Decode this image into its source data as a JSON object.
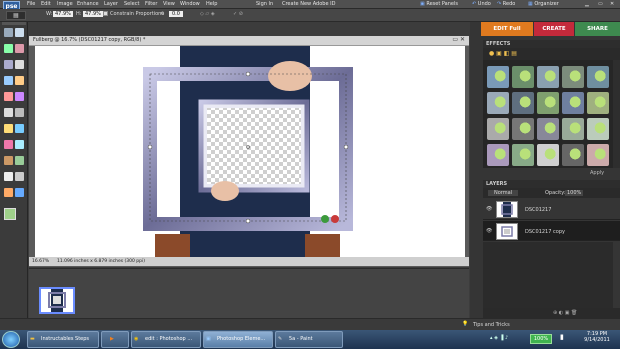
{
  "app": {
    "logo_text": "pse",
    "menu": [
      "File",
      "Edit",
      "Image",
      "Enhance",
      "Layer",
      "Select",
      "Filter",
      "View",
      "Window",
      "Help"
    ],
    "sign_in": "Sign In",
    "create_id": "Create New Adobe ID",
    "reset_panels": "Reset Panels",
    "undo": "Undo",
    "redo": "Redo",
    "organizer": "Organizer"
  },
  "options": {
    "width_label": "W:",
    "width_value": "47.9%",
    "height_label": "H:",
    "height_value": "47.9%",
    "constrain_label": "Constrain Proportions",
    "angle_value": "0.0"
  },
  "tabs": {
    "edit": "EDIT Full",
    "create": "CREATE",
    "share": "SHARE",
    "colors": {
      "edit": "#e07a1f",
      "create": "#c42a3b",
      "share": "#3e8a4f"
    }
  },
  "document": {
    "title": "Fullberg @ 16.7% (DSC01217 copy, RGB/8) *",
    "zoom": "16.67%",
    "size_info": "11.096 inches x 6.879 inches (300 ppi)"
  },
  "effects_panel": {
    "title": "EFFECTS",
    "apply_label": "Apply"
  },
  "layers_panel": {
    "title": "LAYERS",
    "blend_mode": "Normal",
    "opacity_label": "Opacity:",
    "opacity_value": "100%",
    "layers": [
      {
        "name": "DSC01217",
        "selected": false
      },
      {
        "name": "DSC01217 copy",
        "selected": true
      }
    ]
  },
  "tips": {
    "label": "Tips and Tricks"
  },
  "taskbar": {
    "tasks": [
      "Instructables Steps",
      "",
      "edit : Photoshop ...",
      "Photoshop Eleme...",
      "5a - Paint"
    ],
    "battery": "100%",
    "time": "7:19 PM",
    "date": "9/14/2011"
  }
}
